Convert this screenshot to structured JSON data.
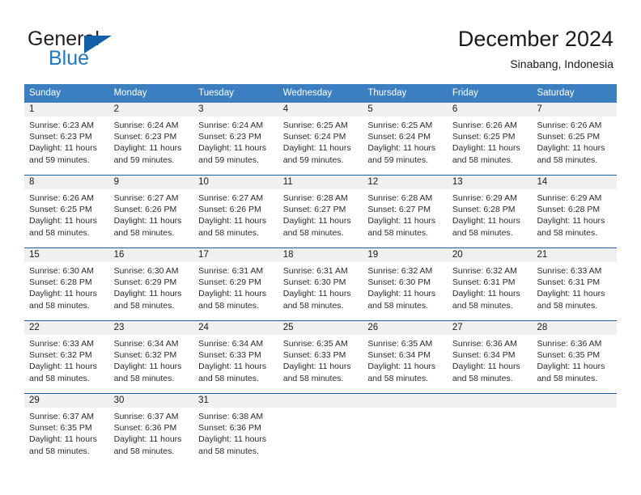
{
  "brand": {
    "name_part1": "General",
    "name_part2": "Blue",
    "logo_icon": "triangle-logo-icon"
  },
  "header": {
    "month_title": "December 2024",
    "location": "Sinabang, Indonesia"
  },
  "colors": {
    "header_band": "#3c7fc1",
    "row_rule": "#1f5fa0",
    "day_band": "#f0f0f0",
    "brand_blue": "#1f78c1",
    "brand_triangle": "#1360a8"
  },
  "calendar": {
    "weekdays": [
      "Sunday",
      "Monday",
      "Tuesday",
      "Wednesday",
      "Thursday",
      "Friday",
      "Saturday"
    ],
    "weeks": [
      [
        {
          "day": "1",
          "sunrise": "Sunrise: 6:23 AM",
          "sunset": "Sunset: 6:23 PM",
          "daylight_line1": "Daylight: 11 hours",
          "daylight_line2": "and 59 minutes."
        },
        {
          "day": "2",
          "sunrise": "Sunrise: 6:24 AM",
          "sunset": "Sunset: 6:23 PM",
          "daylight_line1": "Daylight: 11 hours",
          "daylight_line2": "and 59 minutes."
        },
        {
          "day": "3",
          "sunrise": "Sunrise: 6:24 AM",
          "sunset": "Sunset: 6:23 PM",
          "daylight_line1": "Daylight: 11 hours",
          "daylight_line2": "and 59 minutes."
        },
        {
          "day": "4",
          "sunrise": "Sunrise: 6:25 AM",
          "sunset": "Sunset: 6:24 PM",
          "daylight_line1": "Daylight: 11 hours",
          "daylight_line2": "and 59 minutes."
        },
        {
          "day": "5",
          "sunrise": "Sunrise: 6:25 AM",
          "sunset": "Sunset: 6:24 PM",
          "daylight_line1": "Daylight: 11 hours",
          "daylight_line2": "and 59 minutes."
        },
        {
          "day": "6",
          "sunrise": "Sunrise: 6:26 AM",
          "sunset": "Sunset: 6:25 PM",
          "daylight_line1": "Daylight: 11 hours",
          "daylight_line2": "and 58 minutes."
        },
        {
          "day": "7",
          "sunrise": "Sunrise: 6:26 AM",
          "sunset": "Sunset: 6:25 PM",
          "daylight_line1": "Daylight: 11 hours",
          "daylight_line2": "and 58 minutes."
        }
      ],
      [
        {
          "day": "8",
          "sunrise": "Sunrise: 6:26 AM",
          "sunset": "Sunset: 6:25 PM",
          "daylight_line1": "Daylight: 11 hours",
          "daylight_line2": "and 58 minutes."
        },
        {
          "day": "9",
          "sunrise": "Sunrise: 6:27 AM",
          "sunset": "Sunset: 6:26 PM",
          "daylight_line1": "Daylight: 11 hours",
          "daylight_line2": "and 58 minutes."
        },
        {
          "day": "10",
          "sunrise": "Sunrise: 6:27 AM",
          "sunset": "Sunset: 6:26 PM",
          "daylight_line1": "Daylight: 11 hours",
          "daylight_line2": "and 58 minutes."
        },
        {
          "day": "11",
          "sunrise": "Sunrise: 6:28 AM",
          "sunset": "Sunset: 6:27 PM",
          "daylight_line1": "Daylight: 11 hours",
          "daylight_line2": "and 58 minutes."
        },
        {
          "day": "12",
          "sunrise": "Sunrise: 6:28 AM",
          "sunset": "Sunset: 6:27 PM",
          "daylight_line1": "Daylight: 11 hours",
          "daylight_line2": "and 58 minutes."
        },
        {
          "day": "13",
          "sunrise": "Sunrise: 6:29 AM",
          "sunset": "Sunset: 6:28 PM",
          "daylight_line1": "Daylight: 11 hours",
          "daylight_line2": "and 58 minutes."
        },
        {
          "day": "14",
          "sunrise": "Sunrise: 6:29 AM",
          "sunset": "Sunset: 6:28 PM",
          "daylight_line1": "Daylight: 11 hours",
          "daylight_line2": "and 58 minutes."
        }
      ],
      [
        {
          "day": "15",
          "sunrise": "Sunrise: 6:30 AM",
          "sunset": "Sunset: 6:28 PM",
          "daylight_line1": "Daylight: 11 hours",
          "daylight_line2": "and 58 minutes."
        },
        {
          "day": "16",
          "sunrise": "Sunrise: 6:30 AM",
          "sunset": "Sunset: 6:29 PM",
          "daylight_line1": "Daylight: 11 hours",
          "daylight_line2": "and 58 minutes."
        },
        {
          "day": "17",
          "sunrise": "Sunrise: 6:31 AM",
          "sunset": "Sunset: 6:29 PM",
          "daylight_line1": "Daylight: 11 hours",
          "daylight_line2": "and 58 minutes."
        },
        {
          "day": "18",
          "sunrise": "Sunrise: 6:31 AM",
          "sunset": "Sunset: 6:30 PM",
          "daylight_line1": "Daylight: 11 hours",
          "daylight_line2": "and 58 minutes."
        },
        {
          "day": "19",
          "sunrise": "Sunrise: 6:32 AM",
          "sunset": "Sunset: 6:30 PM",
          "daylight_line1": "Daylight: 11 hours",
          "daylight_line2": "and 58 minutes."
        },
        {
          "day": "20",
          "sunrise": "Sunrise: 6:32 AM",
          "sunset": "Sunset: 6:31 PM",
          "daylight_line1": "Daylight: 11 hours",
          "daylight_line2": "and 58 minutes."
        },
        {
          "day": "21",
          "sunrise": "Sunrise: 6:33 AM",
          "sunset": "Sunset: 6:31 PM",
          "daylight_line1": "Daylight: 11 hours",
          "daylight_line2": "and 58 minutes."
        }
      ],
      [
        {
          "day": "22",
          "sunrise": "Sunrise: 6:33 AM",
          "sunset": "Sunset: 6:32 PM",
          "daylight_line1": "Daylight: 11 hours",
          "daylight_line2": "and 58 minutes."
        },
        {
          "day": "23",
          "sunrise": "Sunrise: 6:34 AM",
          "sunset": "Sunset: 6:32 PM",
          "daylight_line1": "Daylight: 11 hours",
          "daylight_line2": "and 58 minutes."
        },
        {
          "day": "24",
          "sunrise": "Sunrise: 6:34 AM",
          "sunset": "Sunset: 6:33 PM",
          "daylight_line1": "Daylight: 11 hours",
          "daylight_line2": "and 58 minutes."
        },
        {
          "day": "25",
          "sunrise": "Sunrise: 6:35 AM",
          "sunset": "Sunset: 6:33 PM",
          "daylight_line1": "Daylight: 11 hours",
          "daylight_line2": "and 58 minutes."
        },
        {
          "day": "26",
          "sunrise": "Sunrise: 6:35 AM",
          "sunset": "Sunset: 6:34 PM",
          "daylight_line1": "Daylight: 11 hours",
          "daylight_line2": "and 58 minutes."
        },
        {
          "day": "27",
          "sunrise": "Sunrise: 6:36 AM",
          "sunset": "Sunset: 6:34 PM",
          "daylight_line1": "Daylight: 11 hours",
          "daylight_line2": "and 58 minutes."
        },
        {
          "day": "28",
          "sunrise": "Sunrise: 6:36 AM",
          "sunset": "Sunset: 6:35 PM",
          "daylight_line1": "Daylight: 11 hours",
          "daylight_line2": "and 58 minutes."
        }
      ],
      [
        {
          "day": "29",
          "sunrise": "Sunrise: 6:37 AM",
          "sunset": "Sunset: 6:35 PM",
          "daylight_line1": "Daylight: 11 hours",
          "daylight_line2": "and 58 minutes."
        },
        {
          "day": "30",
          "sunrise": "Sunrise: 6:37 AM",
          "sunset": "Sunset: 6:36 PM",
          "daylight_line1": "Daylight: 11 hours",
          "daylight_line2": "and 58 minutes."
        },
        {
          "day": "31",
          "sunrise": "Sunrise: 6:38 AM",
          "sunset": "Sunset: 6:36 PM",
          "daylight_line1": "Daylight: 11 hours",
          "daylight_line2": "and 58 minutes."
        },
        {
          "day": "",
          "sunrise": "",
          "sunset": "",
          "daylight_line1": "",
          "daylight_line2": ""
        },
        {
          "day": "",
          "sunrise": "",
          "sunset": "",
          "daylight_line1": "",
          "daylight_line2": ""
        },
        {
          "day": "",
          "sunrise": "",
          "sunset": "",
          "daylight_line1": "",
          "daylight_line2": ""
        },
        {
          "day": "",
          "sunrise": "",
          "sunset": "",
          "daylight_line1": "",
          "daylight_line2": ""
        }
      ]
    ]
  }
}
